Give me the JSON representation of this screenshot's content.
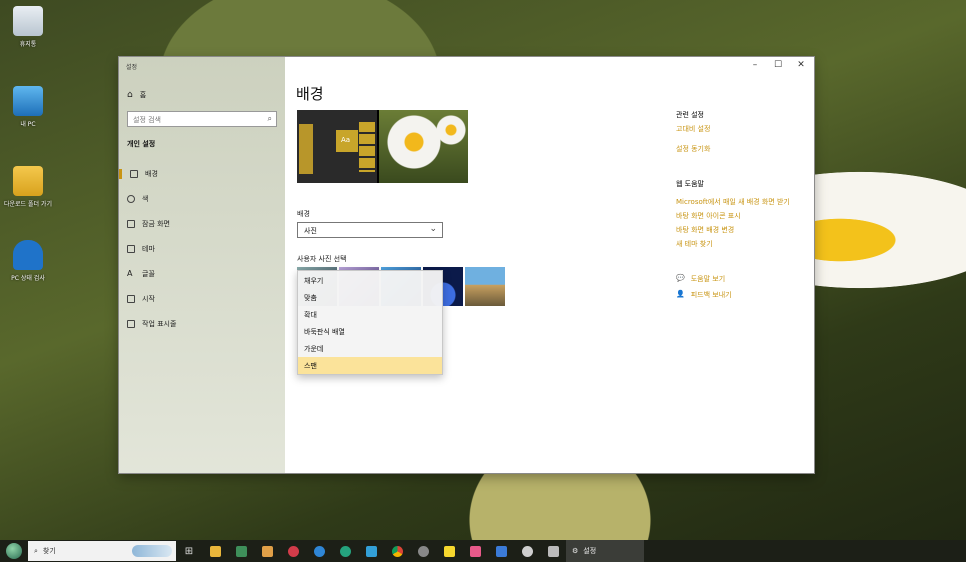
{
  "desktop": {
    "icons": [
      {
        "label": "휴지통",
        "icon": "recycle-bin-icon"
      },
      {
        "label": "내 PC",
        "icon": "computer-icon"
      },
      {
        "label": "다운로드 폴더 가기",
        "icon": "download-folder-icon"
      },
      {
        "label": "PC 상태 검사",
        "icon": "pc-health-icon"
      }
    ]
  },
  "window": {
    "title": "설정",
    "controls": {
      "minimize": "–",
      "maximize": "☐",
      "close": "✕"
    }
  },
  "sidebar": {
    "home": "홈",
    "search_placeholder": "설정 검색",
    "section": "개인 설정",
    "items": [
      {
        "label": "배경",
        "icon": "image-icon"
      },
      {
        "label": "색",
        "icon": "palette-icon"
      },
      {
        "label": "잠금 화면",
        "icon": "lock-screen-icon"
      },
      {
        "label": "테마",
        "icon": "theme-icon"
      },
      {
        "label": "글꼴",
        "icon": "font-icon"
      },
      {
        "label": "시작",
        "icon": "start-icon"
      },
      {
        "label": "작업 표시줄",
        "icon": "taskbar-icon"
      }
    ]
  },
  "main": {
    "heading": "배경",
    "preview_tile": "Aa",
    "background_label": "배경",
    "background_value": "사진",
    "picture_label": "사용자 사진 선택",
    "fit_menu": {
      "options": [
        "채우기",
        "맞춤",
        "확대",
        "바둑판식 배열",
        "가운데",
        "스팬"
      ],
      "selected": "스팬"
    }
  },
  "related": {
    "heading": "관련 설정",
    "links": [
      "고대비 설정",
      "설정 동기화"
    ]
  },
  "web_help": {
    "heading": "웹 도움말",
    "links": [
      "Microsoft에서 매일 새 배경 화면 받기",
      "바탕 화면 아이콘 표시",
      "바탕 화면 배경 변경",
      "새 테마 찾기"
    ]
  },
  "support": {
    "help": "도움말 보기",
    "feedback": "피드백 보내기"
  },
  "taskbar": {
    "search_label": "찾기",
    "settings_label": "설정",
    "pinned": [
      "task-view-icon",
      "file-explorer-icon",
      "calculator-icon",
      "photos-icon",
      "app-icon",
      "edge-legacy-icon",
      "edge-icon",
      "app-icon",
      "chrome-icon",
      "app-icon",
      "kakaotalk-icon",
      "app-icon",
      "app-icon",
      "app-icon",
      "printer-icon"
    ]
  },
  "colors": {
    "accent": "#c89412",
    "selected": "#fbe39a"
  }
}
